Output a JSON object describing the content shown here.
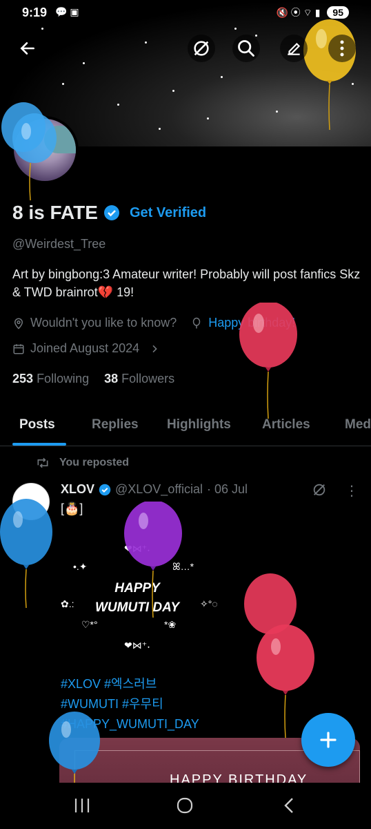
{
  "status_bar": {
    "time": "9:19",
    "battery": "95"
  },
  "profile": {
    "name": "8 is FATE",
    "get_verified": "Get Verified",
    "handle": "@Weirdest_Tree",
    "bio": "Art by bingbong:3 Amateur writer! Probably will post fanfics Skz & TWD brainrot💔 19!",
    "location": "Wouldn't you like to know?",
    "birthday": "Happy birthday!",
    "joined": "Joined August 2024",
    "following_count": "253",
    "following_label": "Following",
    "followers_count": "38",
    "followers_label": "Followers"
  },
  "tabs": [
    "Posts",
    "Replies",
    "Highlights",
    "Articles",
    "Media"
  ],
  "post": {
    "repost_label": "You reposted",
    "author": "XLOV",
    "author_handle": "@XLOV_official",
    "date": "· 06 Jul",
    "first_line": "[🎂]",
    "happy_line1": "HAPPY",
    "happy_line2": "WUMUTI DAY",
    "hashtags_line1": "#XLOV #엑스러브",
    "hashtags_line2": "#WUMUTI #우무티",
    "hashtags_line3": "#HAPPY_WUMUTI_DAY",
    "media_text": "HAPPY BIRTHDAY"
  },
  "colors": {
    "accent": "#1d9bf0",
    "muted": "#71767b",
    "text": "#e7e9ea",
    "background": "#000000"
  },
  "icons": [
    "back-arrow-icon",
    "grok-icon",
    "search-icon",
    "compose-icon",
    "more-icon",
    "location-icon",
    "balloon-icon",
    "calendar-icon",
    "chevron-right-icon",
    "repost-icon",
    "verified-badge-icon",
    "plus-icon"
  ]
}
